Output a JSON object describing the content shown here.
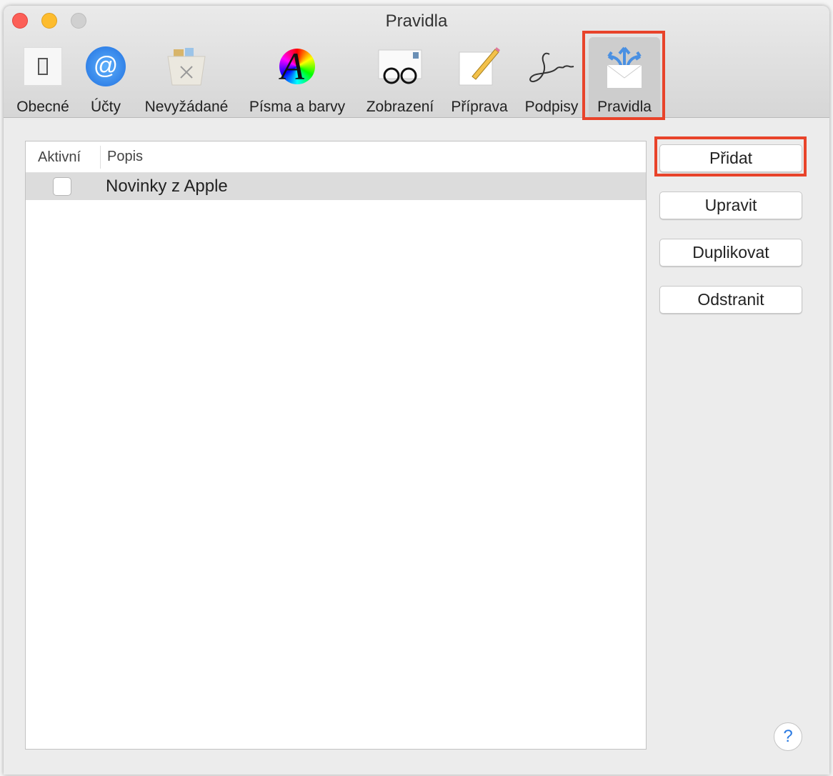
{
  "window": {
    "title": "Pravidla"
  },
  "toolbar": [
    {
      "label": "Obecné",
      "icon": "switch-icon"
    },
    {
      "label": "Účty",
      "icon": "at-icon"
    },
    {
      "label": "Nevyžádané",
      "icon": "junk-bin-icon"
    },
    {
      "label": "Písma a barvy",
      "icon": "font-color-icon"
    },
    {
      "label": "Zobrazení",
      "icon": "glasses-letter-icon"
    },
    {
      "label": "Příprava",
      "icon": "pencil-paper-icon"
    },
    {
      "label": "Podpisy",
      "icon": "signature-icon"
    },
    {
      "label": "Pravidla",
      "icon": "rules-envelope-icon",
      "selected": true
    }
  ],
  "table": {
    "headers": [
      "Aktivní",
      "Popis"
    ],
    "rows": [
      {
        "active": false,
        "description": "Novinky z Apple"
      }
    ]
  },
  "buttons": {
    "add": "Přidat",
    "edit": "Upravit",
    "duplicate": "Duplikovat",
    "remove": "Odstranit",
    "help": "?"
  },
  "colors": {
    "highlight": "#e8432a",
    "accent": "#2a7ae2"
  }
}
